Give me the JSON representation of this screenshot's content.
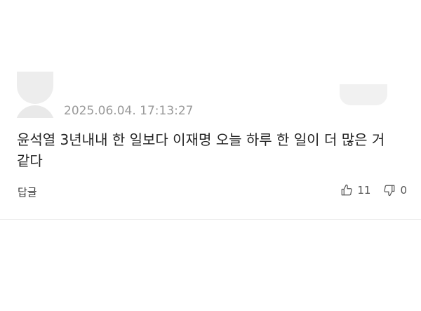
{
  "comment": {
    "timestamp": "2025.06.04. 17:13:27",
    "text": "윤석열 3년내내 한 일보다 이재명 오늘 하루 한 일이 더 많은 거 같다",
    "reply_label": "답글",
    "like_count": "11",
    "dislike_count": "0"
  },
  "icons": {
    "avatar": "default-user-avatar",
    "like": "thumbs-up-icon",
    "dislike": "thumbs-down-icon"
  },
  "colors": {
    "text": "#222222",
    "muted": "#9a9a9a",
    "icon": "#555555",
    "avatar": "#ededed"
  }
}
